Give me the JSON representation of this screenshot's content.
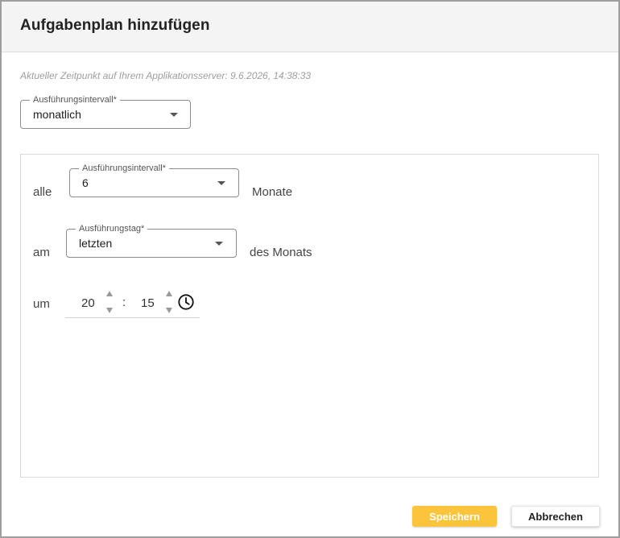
{
  "dialog": {
    "title": "Aufgabenplan hinzufügen",
    "server_time": "Aktueller Zeitpunkt auf Ihrem Applikationsserver: 9.6.2026, 14:38:33"
  },
  "interval_select": {
    "label": "Ausführungsintervall*",
    "value": "monatlich"
  },
  "schedule": {
    "every_label": "alle",
    "months_select": {
      "label": "Ausführungsintervall*",
      "value": "6"
    },
    "months_suffix": "Monate",
    "on_label": "am",
    "day_select": {
      "label": "Ausführungstag*",
      "value": "letzten"
    },
    "day_suffix": "des Monats",
    "at_label": "um",
    "time": {
      "hours": "20",
      "separator": ":",
      "minutes": "15"
    }
  },
  "icons": {
    "dropdown": "chevron-down-icon",
    "spin_up": "arrow-up-icon",
    "spin_down": "arrow-down-icon",
    "clock": "clock-icon"
  },
  "colors": {
    "primary": "#fcc43c",
    "header_bg": "#f4f4f4"
  },
  "actions": {
    "save_label": "Speichern",
    "cancel_label": "Abbrechen"
  }
}
